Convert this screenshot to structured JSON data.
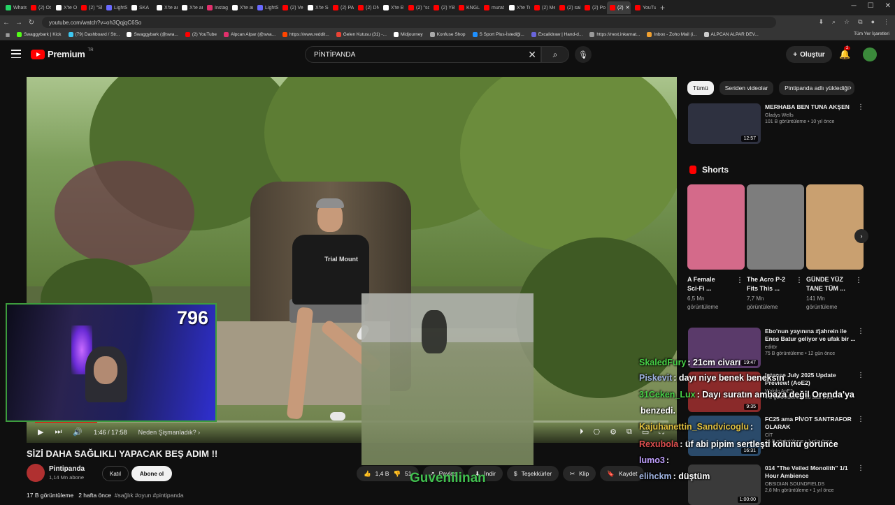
{
  "browser": {
    "tabs": [
      {
        "label": "Whats",
        "color": "#25d366"
      },
      {
        "label": "(2) Ot",
        "color": "#ff0000"
      },
      {
        "label": "X'te Ot",
        "color": "#ffffff"
      },
      {
        "label": "(2) \"Sh",
        "color": "#ff0000"
      },
      {
        "label": "LightSh",
        "color": "#6a6aff"
      },
      {
        "label": "SKA",
        "color": "#ffffff"
      },
      {
        "label": "X'te ara",
        "color": "#ffffff"
      },
      {
        "label": "X'te ara",
        "color": "#ffffff"
      },
      {
        "label": "Instagr",
        "color": "#e1306c"
      },
      {
        "label": "X'te ara",
        "color": "#ffffff"
      },
      {
        "label": "LightSh",
        "color": "#6a6aff"
      },
      {
        "label": "(2) Vel",
        "color": "#ff0000"
      },
      {
        "label": "X'te Sc",
        "color": "#ffffff"
      },
      {
        "label": "(2) PA",
        "color": "#ff0000"
      },
      {
        "label": "(2) DN",
        "color": "#ff0000"
      },
      {
        "label": "X'te Ev",
        "color": "#ffffff"
      },
      {
        "label": "(2) \"sc",
        "color": "#ff0000"
      },
      {
        "label": "(2) YB",
        "color": "#ff0000"
      },
      {
        "label": "KNGL",
        "color": "#ff0000"
      },
      {
        "label": "murat",
        "color": "#ff0000"
      },
      {
        "label": "X'te Tu",
        "color": "#ffffff"
      },
      {
        "label": "(2) Me",
        "color": "#ff0000"
      },
      {
        "label": "(2) sai",
        "color": "#ff0000"
      },
      {
        "label": "(2) Pol",
        "color": "#ff0000"
      },
      {
        "label": "(2)",
        "color": "#ff0000",
        "active": true
      },
      {
        "label": "YouTu",
        "color": "#ff0000"
      }
    ],
    "url": "youtube.com/watch?v=oh3QqjqC6So",
    "bookmarks": [
      {
        "label": "Swaggybark | Kick",
        "color": "#53fc18"
      },
      {
        "label": "(79) Dashboard / Str...",
        "color": "#3ec7f0"
      },
      {
        "label": "Swaggybark (@swa...",
        "color": "#ffffff"
      },
      {
        "label": "(2) YouTube",
        "color": "#ff0000"
      },
      {
        "label": "Alpcan Alpar (@swa...",
        "color": "#e1306c"
      },
      {
        "label": "https://www.reddit...",
        "color": "#ff4500"
      },
      {
        "label": "Gelen Kutusu (31) -...",
        "color": "#ea4335"
      },
      {
        "label": "Midjourney",
        "color": "#ffffff"
      },
      {
        "label": "Konfuse Shop",
        "color": "#aaaaaa"
      },
      {
        "label": "S Sport Plus-İstediği...",
        "color": "#1e90ff"
      },
      {
        "label": "Excalidraw | Hand-d...",
        "color": "#6965db"
      },
      {
        "label": "https://nest.inkarnat...",
        "color": "#999999"
      },
      {
        "label": "Inbox - Zoho Mail (i...",
        "color": "#f0a030"
      },
      {
        "label": "ALPCAN ALPAR DEV...",
        "color": "#cccccc"
      }
    ],
    "all_bookmarks": "Tüm Yer İşaretleri"
  },
  "header": {
    "logo_text": "Premium",
    "region": "TR",
    "search_value": "PİNTİPANDA",
    "create_label": "Oluştur",
    "notifications": "2"
  },
  "player": {
    "time": "1:46 / 17:58",
    "chapter": "Neden Şişmanladık? ›",
    "progress": 0.098,
    "shirt_text": "Trial Mount"
  },
  "overlay": {
    "viewer_count": "796",
    "gif_caption": "Guvenilinan"
  },
  "video": {
    "title": "SİZİ DAHA SAĞLIKLI YAPACAK BEŞ ADIM !!",
    "channel": "Pintipanda",
    "subscribers": "1,14 Mn abone",
    "join_label": "Katıl",
    "subscribe_label": "Abone ol",
    "likes": "1,4 B",
    "dislikes_label": "51",
    "share_label": "Paylaş",
    "download_label": "İndir",
    "thanks_label": "Teşekkürler",
    "clip_label": "Klip",
    "save_label": "Kaydet",
    "views": "17 B görüntüleme",
    "age": "2 hafta önce",
    "tags": "#sağlık #oyun #pintipanda"
  },
  "chips": [
    "Tümü",
    "Seriden videolar",
    "Pintipanda adlı yüklediği"
  ],
  "recommended_top": {
    "title": "MERHABA BEN TUNA AKŞEN",
    "channel": "Gladys Wells",
    "stats": "101 B görüntüleme • 10 yıl önce",
    "duration": "12:57"
  },
  "shorts": {
    "heading": "Shorts",
    "items": [
      {
        "title_l1": "A Female",
        "title_l2": "Sci-Fi ...",
        "views_l1": "6,5 Mn",
        "views_l2": "görüntüleme",
        "thumb_color": "#d46a8a"
      },
      {
        "title_l1": "The Acro P-2",
        "title_l2": "Fits This ...",
        "views_l1": "7,7 Mn",
        "views_l2": "görüntüleme",
        "thumb_color": "#7d7d7d"
      },
      {
        "title_l1": "GÜNDE YÜZ",
        "title_l2": "TANE TÜM ...",
        "views_l1": "141 Mn",
        "views_l2": "görüntüleme",
        "thumb_color": "#c9a070"
      }
    ]
  },
  "recommended": [
    {
      "title_l1": "Ebo'nun yayınına #jahrein ile",
      "title_l2": "Enes Batur geliyor ve ufak bir ...",
      "channel": "editör",
      "stats": "75 B görüntüleme • 12 gün önce",
      "duration": "19:47",
      "thumb_color": "#5a3a6a"
    },
    {
      "title_l1": "Intense July 2025 Update",
      "title_l2": "Preview! (AoE2)",
      "channel": "Wololo AoE2",
      "stats": "4 B görüntüleme • 23 saat önce",
      "duration": "9:35",
      "thumb_color": "#8a2a2a"
    },
    {
      "title_l1": "FC25 ama PİVOT SANTRAFOR",
      "title_l2": "OLARAK",
      "channel": "CİT",
      "stats": "26 B görüntüleme • 1 gün önce",
      "duration": "16:31",
      "thumb_color": "#2a4a6a"
    },
    {
      "title_l1": "014 \"The Veiled Monolith\" 1/1",
      "title_l2": "Hour Ambience",
      "channel": "OBSIDIAN SOUNDFIELDS",
      "stats": "2,8 Mn görüntüleme • 1 yıl önce",
      "duration": "1:00:00",
      "thumb_color": "#3a3a3a"
    }
  ],
  "chat": [
    {
      "user": "SkaledFury",
      "msg": ": 21cm civarı",
      "color": "#47d147"
    },
    {
      "user": "Piskevit",
      "msg": ": dayı niye benek beneksin",
      "color": "#9fb3e0"
    },
    {
      "user": "31Ceken_Lux",
      "msg": ": Dayı suratın ambaza değil Orenda'ya",
      "color": "#47d147"
    },
    {
      "user": "",
      "msg": "benzedi.",
      "color": "#ffffff"
    },
    {
      "user": "Kajuhanettin_Sandvicoglu",
      "msg": ":",
      "color": "#e0c040"
    },
    {
      "user": "Rexubola",
      "msg": ": üf abi pipim sertleşti kolunu görünce",
      "color": "#e05050"
    },
    {
      "user": "lumo3",
      "msg": ":",
      "color": "#c0a0ff"
    },
    {
      "user": "elihckm",
      "msg": ": düştüm",
      "color": "#9fb3e0"
    }
  ]
}
